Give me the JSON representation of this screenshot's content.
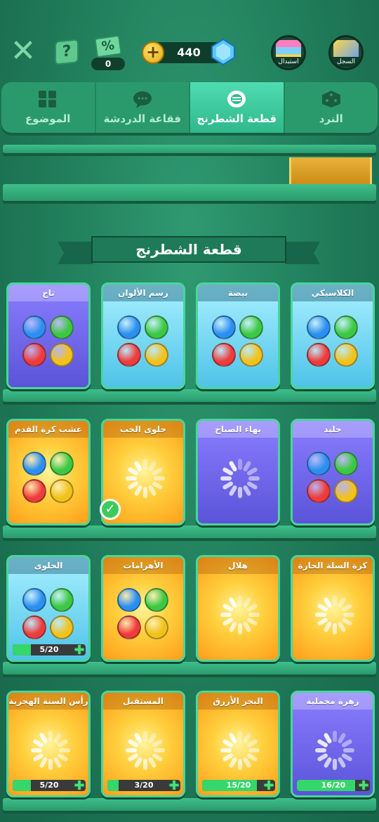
{
  "header": {
    "close_icon": "close-icon",
    "help_icon": "help-icon",
    "coupon": {
      "symbol": "%",
      "count": "0"
    },
    "coins": {
      "plus": "+",
      "value": "440"
    },
    "exchange_label": "استبدال",
    "record_label": "السجل"
  },
  "tabs": [
    {
      "label": "النرد",
      "icon": "dice-icon",
      "active": false
    },
    {
      "label": "قطعة الشطرنج",
      "icon": "chess-piece-icon",
      "active": true
    },
    {
      "label": "فقاعة الدردشة",
      "icon": "chat-bubble-icon",
      "active": false
    },
    {
      "label": "الموضوع",
      "icon": "theme-grid-icon",
      "active": false
    }
  ],
  "section_title": "قطعة الشطرنج",
  "rows": [
    [
      {
        "name": "الكلاسيكي",
        "style": "cyan",
        "content": "pieces"
      },
      {
        "name": "بيضة",
        "style": "cyan",
        "content": "pieces"
      },
      {
        "name": "رسم الألوان",
        "style": "cyan",
        "content": "pieces"
      },
      {
        "name": "تاج",
        "style": "purple",
        "content": "pieces"
      }
    ],
    [
      {
        "name": "جليد",
        "style": "purple",
        "content": "pieces"
      },
      {
        "name": "بهاء الصباح",
        "style": "purple",
        "content": "loading"
      },
      {
        "name": "حلوى الحب",
        "style": "orange",
        "content": "loading",
        "owned": true
      },
      {
        "name": "عشب كرة القدم",
        "style": "orange",
        "content": "pieces"
      }
    ],
    [
      {
        "name": "كرة السلة الحارة",
        "style": "orange",
        "content": "loading"
      },
      {
        "name": "هلال",
        "style": "orange",
        "content": "loading"
      },
      {
        "name": "الأهرامات",
        "style": "orange",
        "content": "pieces"
      },
      {
        "name": "الحلوى",
        "style": "cyan",
        "content": "pieces",
        "progress": "5/20",
        "progress_value": 0.25
      }
    ],
    [
      {
        "name": "زهرة مخملية",
        "style": "purple",
        "content": "loading",
        "progress": "16/20",
        "progress_value": 0.8
      },
      {
        "name": "البحر الأزرق",
        "style": "orange",
        "content": "loading",
        "progress": "15/20",
        "progress_value": 0.75
      },
      {
        "name": "المستقبل",
        "style": "orange",
        "content": "loading",
        "progress": "3/20",
        "progress_value": 0.15
      },
      {
        "name": "رأس السنة الهجرية",
        "style": "orange",
        "content": "loading",
        "progress": "5/20",
        "progress_value": 0.25
      }
    ]
  ],
  "colors": {
    "accent": "#2fb88a",
    "background": "#1f7a58",
    "progress_fill": "#35d66a"
  }
}
